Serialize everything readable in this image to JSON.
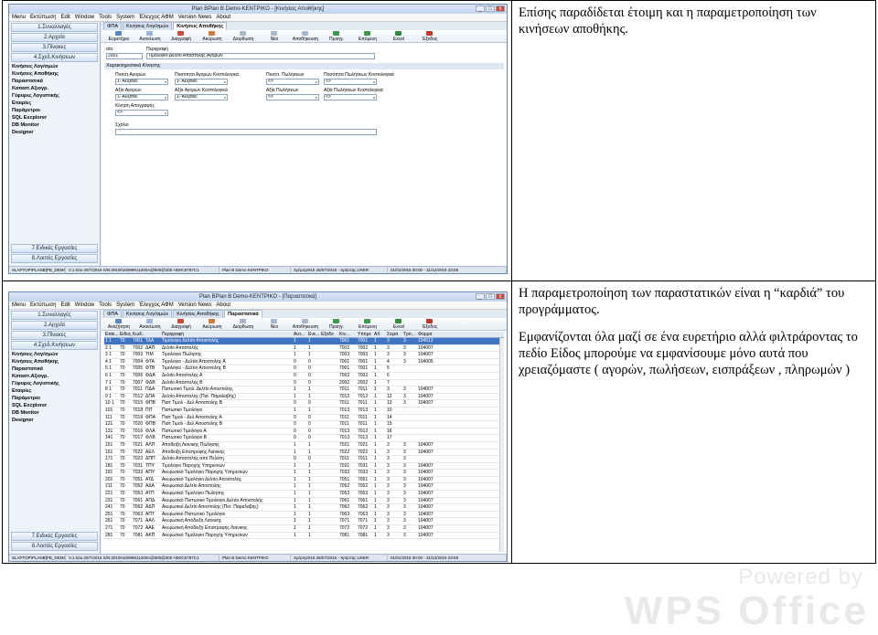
{
  "text_blocks": {
    "row1": [
      "Επίσης παραδίδεται έτοιμη και η παραμετροποίηση των κινήσεων αποθήκης."
    ],
    "row2": [
      "Η παραμετροποίηση των παραστατικών είναι η “καρδιά” του προγράμματος.",
      "Εμφανίζονται όλα μαζί σε ένα ευρετήριο αλλά φιλτράροντας το πεδίο Είδος μπορούμε να εμφανίσουμε μόνο αυτά που χρειαζόμαστε ( αγορών, πωλήσεων, εισπράξεων , πληρωμών )"
    ]
  },
  "screenshot1": {
    "window_title": "Plan BPlan B Demo-KENTPIKO - [Κινήσεις Αποθήκης]",
    "menu": [
      "Menu",
      "Εκτύπωση",
      "Edit",
      "Window",
      "Tools",
      "System",
      "Έλεγχος ΑΦΜ",
      "Version News",
      "About"
    ],
    "tabs": [
      "ΦΠΑ",
      "Κινήσεις Λογ/σμών",
      "Κινήσεις Αποθήκης"
    ],
    "toolbar": [
      "Ευρετήριο",
      "Ανανέωση",
      "Διαγραφή",
      "Ακύρωση",
      "Διόρθωση",
      "Νέο",
      "Αποθήκευση",
      "Προηγ.",
      "Επόμενη",
      "Excel",
      "Έξοδος"
    ],
    "form": {
      "aa_label": "α/α",
      "desc_label": "Περιγραφή",
      "aa_value": "2001",
      "desc_value": "Τιμολόγιο-Δελτίο Αποστολής Αγορών",
      "section": "Χαρακτηριστικά Κίνησης",
      "labels": [
        "Ποσότ.Αγορών",
        "Ποσότητα Αγορών Κοστολογικά",
        "Ποσότ. Πωλήσεων",
        "Ποσότητα Πωλήσεων Κοστολογικά",
        "Αξία Αγορών",
        "Αξία Αγορών Κοστολογικά",
        "Αξία Πωλήσεων",
        "Αξία Πωλήσεων Κοστολογικά",
        "Κίνηση Απογραφής",
        "Σχόλιο"
      ],
      "values": [
        "1- Αυξάνει",
        "1- Αυξάνει",
        "<>",
        "<>",
        "1- Αυξάνει",
        "1- Αυξάνει",
        "<>",
        "<>",
        "<>"
      ]
    },
    "status": [
      "SLAPTOP\\PLANB[PB_DEMO]",
      "V.1.02a 20/7/2015 S/N:3010010099911200A@500@300 HD0C6787C1",
      "Plan B Demo KENTPIKO",
      "Χρήση2015 26/07/2015 - Χρήστης:USER",
      "01/01/2015 00:00 - 31/12/2015 23:59"
    ]
  },
  "screenshot2": {
    "window_title": "Plan BPlan B Demo-KENTPIKO - [Παραστατικά]",
    "menu": [
      "Menu",
      "Εκτύπωση",
      "Edit",
      "Window",
      "Tools",
      "System",
      "Έλεγχος ΑΦΜ",
      "Version News",
      "About"
    ],
    "tabs": [
      "ΦΠΑ",
      "Κινήσεις Λογ/σμών",
      "Κινήσεις Αποθήκης",
      "Παραστατικά"
    ],
    "toolbar": [
      "Αναζήτηση",
      "Ανανέωση",
      "Διαγραφή",
      "Ακύρωση",
      "Διόρθωση",
      "Νέο",
      "Αποθήκευση",
      "Προηγ.",
      "Επόμενη",
      "Excel",
      "Έξοδος"
    ],
    "grid_headers": [
      "Εταιι...",
      "Είδος",
      "Κωδ...",
      "",
      "Περιγραφή",
      "Αυτ...",
      "Ενε...",
      "Εξοδο",
      "Κιν...",
      "Υπόμε",
      "ΑΧ",
      "Σειρά",
      "Τρό...",
      "Φόρμα"
    ],
    "rows": [
      [
        "1 1",
        "70",
        "7001",
        "ΤΔΑ",
        "Τιμολόγιο Δελτίο Αποστολής",
        "1",
        "1",
        "",
        "7001",
        "7001",
        "1",
        "3",
        "3",
        "104012"
      ],
      [
        "2 1",
        "70",
        "7002",
        "ΔΑΠ",
        "Δελτίο Αποστολής",
        "1",
        "1",
        "",
        "7002",
        "7002",
        "1",
        "3",
        "3",
        "104007"
      ],
      [
        "3 1",
        "70",
        "7003",
        "ΤΙΜ",
        "Τιμολόγιο Πώλησης",
        "1",
        "1",
        "",
        "7003",
        "7003",
        "1",
        "3",
        "3",
        "104007"
      ],
      [
        "4 1",
        "70",
        "7004",
        "ΦΤΑ",
        "Τιμολόγιο - Δελτίο Αποστολής Α",
        "0",
        "0",
        "",
        "7001",
        "7001",
        "1",
        "4",
        "3",
        "104005"
      ],
      [
        "5 1",
        "70",
        "7005",
        "ΦΤΒ",
        "Τιμολόγιο - Δελτίο Αποστολής Β",
        "0",
        "0",
        "",
        "7001",
        "7001",
        "1",
        "5",
        "",
        ""
      ],
      [
        "6 1",
        "70",
        "7006",
        "ΦΔΑ",
        "Δελτίο Αποστολής Α",
        "0",
        "0",
        "",
        "7002",
        "7002",
        "1",
        "6",
        "",
        ""
      ],
      [
        "7 1",
        "70",
        "7007",
        "ΦΔΒ",
        "Δελτίο Αποστολής Β",
        "0",
        "0",
        "",
        "2002",
        "2002",
        "1",
        "7",
        "",
        ""
      ],
      [
        "8 1",
        "70",
        "7011",
        "ΠΔΑ",
        "Πιστωτικό Τιμολ. Δελτίο Αποστολής",
        "1",
        "1",
        "",
        "7011",
        "7011",
        "1",
        "3",
        "3",
        "104007"
      ],
      [
        "9 1",
        "70",
        "7012",
        "ΔΠΑ",
        "Δελτίο Αποστολής (Πισ. Παραλαβής)",
        "1",
        "1",
        "",
        "7012",
        "7012",
        "1",
        "12",
        "3",
        "104007"
      ],
      [
        "10 1",
        "70",
        "7015",
        "ΦΠΒ",
        "Πιστ Τιμολ - Δελ Αποστολής Β",
        "0",
        "0",
        "",
        "7011",
        "7011",
        "1",
        "13",
        "3",
        "104007"
      ],
      [
        "101",
        "70",
        "7018",
        "ΠΙΤ",
        "Πιστωτικό Τιμολόγιο",
        "1",
        "1",
        "",
        "7013",
        "7013",
        "1",
        "10",
        "",
        ""
      ],
      [
        "111",
        "70",
        "7019",
        "ΦΠΑ",
        "Πιστ Τιμολ - Δελ Αποστολής Α",
        "0",
        "0",
        "",
        "7011",
        "7011",
        "1",
        "14",
        "",
        ""
      ],
      [
        "121",
        "70",
        "7020",
        "ΦΠΒ",
        "Πιστ Τιμολ - Δελ Αποστολής Β",
        "0",
        "0",
        "",
        "7011",
        "7011",
        "1",
        "15",
        "",
        ""
      ],
      [
        "131",
        "70",
        "7016",
        "ΦΛΑ",
        "Πιστωτικό Τιμολόγιο Α",
        "0",
        "0",
        "",
        "7013",
        "7013",
        "1",
        "16",
        "",
        ""
      ],
      [
        "141",
        "70",
        "7017",
        "ΦΛΒ",
        "Πιστωτικό Τιμολόγιο Β",
        "0",
        "0",
        "",
        "7013",
        "7013",
        "1",
        "17",
        "",
        ""
      ],
      [
        "151",
        "70",
        "7021",
        "ΑΛΠ",
        "Απόδειξη Λιανικής Πώλησης",
        "1",
        "1",
        "",
        "7021",
        "7021",
        "1",
        "3",
        "3",
        "104007"
      ],
      [
        "161",
        "70",
        "7022",
        "ΑΕΛ",
        "Απόδειξη Επιστροφής Λιανικής",
        "1",
        "1",
        "",
        "7022",
        "7022",
        "1",
        "3",
        "3",
        "104007"
      ],
      [
        "171",
        "70",
        "7023",
        "ΔΠΠ",
        "Δελτίο Αποστολής από Πελάτη",
        "0",
        "0",
        "",
        "7011",
        "7011",
        "1",
        "3",
        "3",
        ""
      ],
      [
        "181",
        "70",
        "7031",
        "ΤΠΥ",
        "Τιμολόγιο Παροχής Υπηρεσιών",
        "1",
        "1",
        "",
        "7031",
        "7031",
        "1",
        "3",
        "3",
        "104007"
      ],
      [
        "191",
        "70",
        "7033",
        "ΑΠΥ",
        "Ακυρωτικό Τιμολόγιο Παροχής Υπηρεσιών",
        "1",
        "1",
        "",
        "7033",
        "7033",
        "1",
        "3",
        "3",
        "104007"
      ],
      [
        "201",
        "70",
        "7051",
        "ΑΤΔ",
        "Ακυρωτικό Τιμολόγιο Δελτίο Αποστολής",
        "1",
        "1",
        "",
        "7051",
        "7051",
        "1",
        "3",
        "3",
        "104007"
      ],
      [
        "211",
        "70",
        "7052",
        "ΑΔΑ",
        "Ακυρωτικό Δελτίο Αποστολής",
        "1",
        "1",
        "",
        "7052",
        "7052",
        "1",
        "3",
        "3",
        "104007"
      ],
      [
        "221",
        "70",
        "7053",
        "ΑΤΠ",
        "Ακυρωτικό Τιμολόγιο Πώλησης",
        "1",
        "1",
        "",
        "7053",
        "7053",
        "1",
        "3",
        "3",
        "104007"
      ],
      [
        "231",
        "70",
        "7061",
        "ΑΠΔ",
        "Ακυρωτικό Πιστωτικό Τιμολόγιο Δελτίο Αποστολής",
        "1",
        "1",
        "",
        "7061",
        "7061",
        "1",
        "3",
        "3",
        "104007"
      ],
      [
        "241",
        "70",
        "7062",
        "ΑΔΠ",
        "Ακυρωτικό Δελτίο Αποστολής (Πισ. Παραλαβής)",
        "1",
        "1",
        "",
        "7062",
        "7062",
        "1",
        "3",
        "3",
        "104007"
      ],
      [
        "251",
        "70",
        "7063",
        "ΑΠΤ",
        "Ακυρωτικό Πιστωτικό Τιμολόγιο",
        "1",
        "1",
        "",
        "7063",
        "7063",
        "1",
        "3",
        "3",
        "104007"
      ],
      [
        "261",
        "70",
        "7071",
        "ΑΑΛ",
        "Ακυρωτική Απόδειξη Λιανικής",
        "1",
        "1",
        "",
        "7071",
        "7071",
        "1",
        "3",
        "3",
        "104007"
      ],
      [
        "271",
        "70",
        "7072",
        "ΑΑΕ",
        "Ακυρωτική Απόδειξη Επιστροφής Λιανικής",
        "1",
        "1",
        "",
        "7072",
        "7072",
        "1",
        "3",
        "3",
        "104007"
      ],
      [
        "281",
        "70",
        "7081",
        "ΑΚΠ",
        "Ακυρωτικό Τιμολόγιο Παροχής Υπηρεσιών",
        "1",
        "1",
        "",
        "7081",
        "7081",
        "1",
        "3",
        "3",
        "104007"
      ]
    ],
    "status": [
      "SLAPTOP\\PLANB[PB_DEMO]",
      "V.1.02a 20/7/2015 S/N:3010010099911200A@500@300 HD0C6787C1",
      "Plan B Demo KENTPIKO",
      "Χρήση2015 26/07/2015 - Χρήστης:USER",
      "01/01/2015 00:00 - 31/12/2015 23:59"
    ]
  },
  "sidebar": {
    "top_buttons": [
      "1.Συναλλαγές",
      "2.Αρχεία",
      "3.Πίνακες",
      "4.Σχεδ.Κινήσεων"
    ],
    "items": [
      "Κινήσεις Λογ/σμών",
      "Κινήσεις Αποθήκης",
      "Παραστατικά",
      "Καταστ.Αξιογρ.",
      "Γέφυρες Λογιστικής",
      "Εταιρίες",
      "Παράμετροι",
      "SQL Excplorer",
      "DB Monitor",
      "Designer"
    ],
    "bottom_buttons": [
      "7.Ειδικές Εργασίες",
      "8.Λοιπές Εργασίες"
    ]
  },
  "watermark": {
    "powered": "Powered by",
    "logo": "WPS Office"
  }
}
